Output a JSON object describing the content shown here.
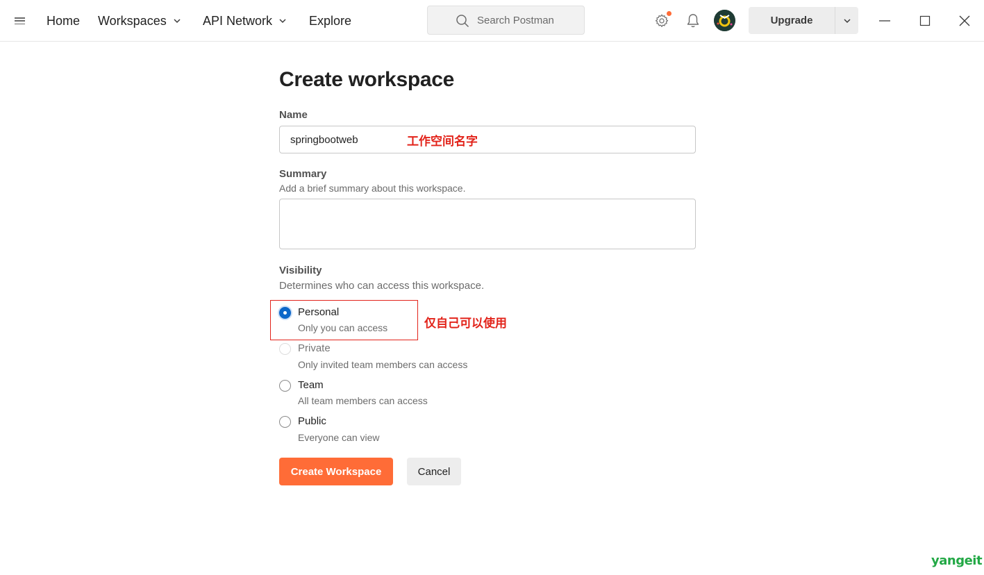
{
  "nav": {
    "menu_icon": "hamburger-menu-icon",
    "home": "Home",
    "workspaces": "Workspaces",
    "api_network": "API Network",
    "explore": "Explore"
  },
  "search": {
    "placeholder": "Search Postman",
    "icon": "search-icon"
  },
  "header_icons": {
    "settings": "gear-icon",
    "notifications": "bell-icon",
    "avatar": "avatar"
  },
  "upgrade": {
    "label": "Upgrade"
  },
  "window_controls": [
    "minimize-icon",
    "maximize-icon",
    "close-icon"
  ],
  "form": {
    "title": "Create workspace",
    "name": {
      "label": "Name",
      "value": "springbootweb",
      "annotation": "工作空间名字"
    },
    "summary": {
      "label": "Summary",
      "help": "Add a brief summary about this workspace.",
      "value": ""
    },
    "visibility": {
      "label": "Visibility",
      "help": "Determines who can access this workspace.",
      "annotation": "仅自己可以使用",
      "selected": "Personal",
      "options": [
        {
          "label": "Personal",
          "description": "Only you can access"
        },
        {
          "label": "Private",
          "description": "Only invited team members can access"
        },
        {
          "label": "Team",
          "description": "All team members can access"
        },
        {
          "label": "Public",
          "description": "Everyone can view"
        }
      ]
    },
    "submit_label": "Create Workspace",
    "cancel_label": "Cancel"
  },
  "colors": {
    "accent": "#ff6c37",
    "radio_selected": "#0c67c9",
    "annotation": "#e2231a",
    "watermark": "#22a845"
  },
  "watermark": "yangeit"
}
